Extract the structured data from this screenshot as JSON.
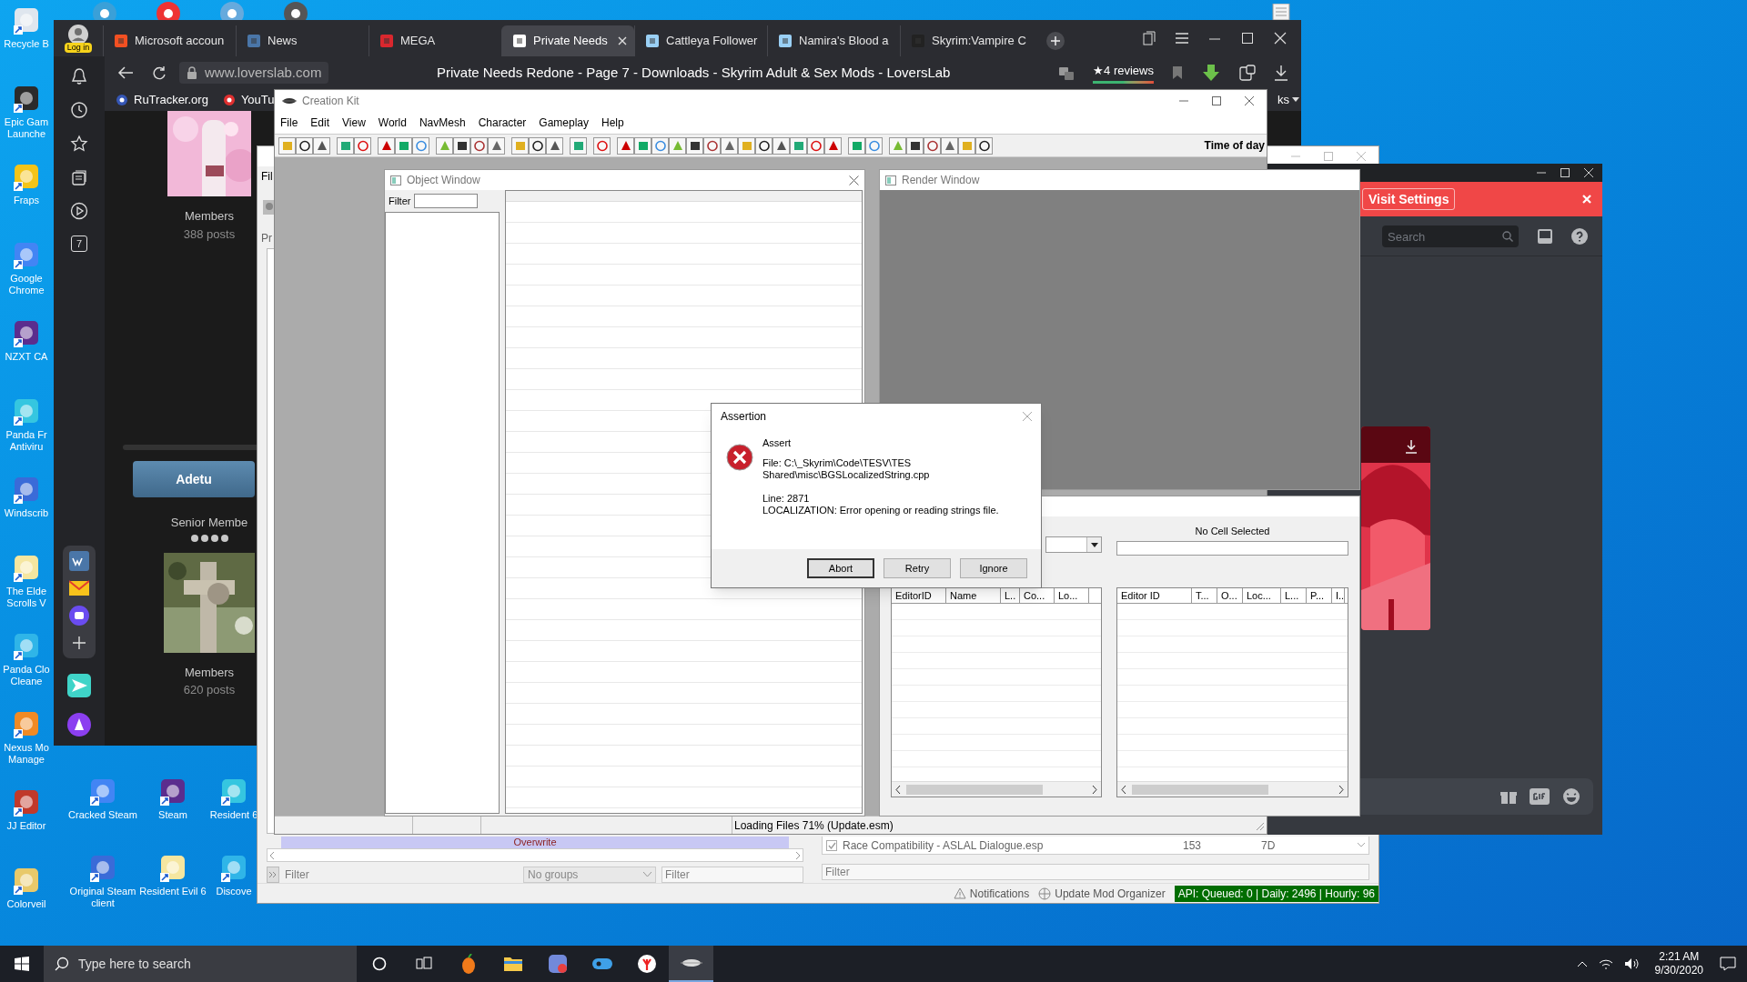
{
  "desktop": {
    "left_column": [
      "Recycle B",
      "Epic Gam Launche",
      "Fraps",
      "Google Chrome",
      "NZXT CA",
      "Panda Fr Antiviru",
      "Windscrib",
      "The Elde Scrolls V",
      "Panda Clo Cleane",
      "Nexus Mo Manage",
      "JJ Editor",
      "Colorveil"
    ],
    "bottom_rows": [
      [
        "Cracked Steam",
        "Steam",
        "Resident 6"
      ],
      [
        "Original Steam client",
        "Resident Evil 6",
        "Discove"
      ]
    ]
  },
  "browser": {
    "login_badge": "Log in",
    "tabs": [
      {
        "label": "Microsoft accoun",
        "selected": false
      },
      {
        "label": "News",
        "selected": false
      },
      {
        "label": "MEGA",
        "selected": false
      },
      {
        "label": "Private Needs",
        "selected": true
      },
      {
        "label": "Cattleya Follower",
        "selected": false
      },
      {
        "label": "Namira's Blood a",
        "selected": false
      },
      {
        "label": "Skyrim:Vampire C",
        "selected": false
      }
    ],
    "address": "www.loverslab.com",
    "page_title": "Private Needs Redone - Page 7 - Downloads - Skyrim Adult & Sex Mods - LoversLab",
    "reviews": "★4 reviews",
    "bookmarks": [
      "RuTracker.org",
      "YouTu"
    ],
    "bookmarks_more": "ks",
    "sidebar_badge": "7",
    "page": {
      "first_poster": {
        "group": "Members",
        "posts": "388 posts"
      },
      "author": "Adetu",
      "author_rank": "Senior Membe",
      "stars": 4,
      "second_poster": {
        "group": "Members",
        "posts": "620 posts"
      }
    }
  },
  "mod_organizer": {
    "menu_cut": "Fil",
    "tab_cut": "Pr",
    "overwrite": "Overwrite",
    "mods_filter": {
      "placeholder": "Filter"
    },
    "groups": "No groups",
    "category_filter": {
      "placeholder": "Filter"
    },
    "plugin": {
      "name": "Race Compatibility - ASLAL Dialogue.esp",
      "priority": "153",
      "index": "7D",
      "checked": true
    },
    "plugins_filter": {
      "placeholder": "Filter"
    },
    "notifications": "Notifications",
    "update": "Update Mod Organizer",
    "api": "API: Queued: 0 | Daily: 2496 | Hourly: 96"
  },
  "creation_kit": {
    "title": "Creation Kit",
    "menu": [
      "File",
      "Edit",
      "View",
      "World",
      "NavMesh",
      "Character",
      "Gameplay",
      "Help"
    ],
    "time_of_day": "Time of day",
    "object_window": {
      "title": "Object Window",
      "filter_label": "Filter"
    },
    "render_window": {
      "title": "Render Window"
    },
    "cell_view": {
      "cell_label": "No Cell Selected",
      "cells_columns": [
        "EditorID",
        "Name",
        "L..",
        "Co...",
        "Lo..."
      ],
      "refs_columns": [
        "Editor ID",
        "T...",
        "O...",
        "Loc...",
        "L...",
        "P...",
        "I.."
      ]
    },
    "status": "Loading Files 71% (Update.esm)"
  },
  "assertion": {
    "title": "Assertion",
    "heading": "Assert",
    "file": "File: C:\\_Skyrim\\Code\\TESV\\TES Shared\\misc\\BGSLocalizedString.cpp",
    "line": "Line: 2871",
    "message": "LOCALIZATION: Error opening or reading strings file.",
    "buttons": [
      {
        "label": "Abort",
        "selected": true
      },
      {
        "label": "Retry",
        "selected": false
      },
      {
        "label": "Ignore",
        "selected": false
      }
    ]
  },
  "discord": {
    "banner_button": "Visit Settings",
    "search": {
      "placeholder": "Search"
    }
  },
  "taskbar": {
    "search": {
      "placeholder": "Type here to search"
    },
    "time": "2:21 AM",
    "date": "9/30/2020"
  }
}
